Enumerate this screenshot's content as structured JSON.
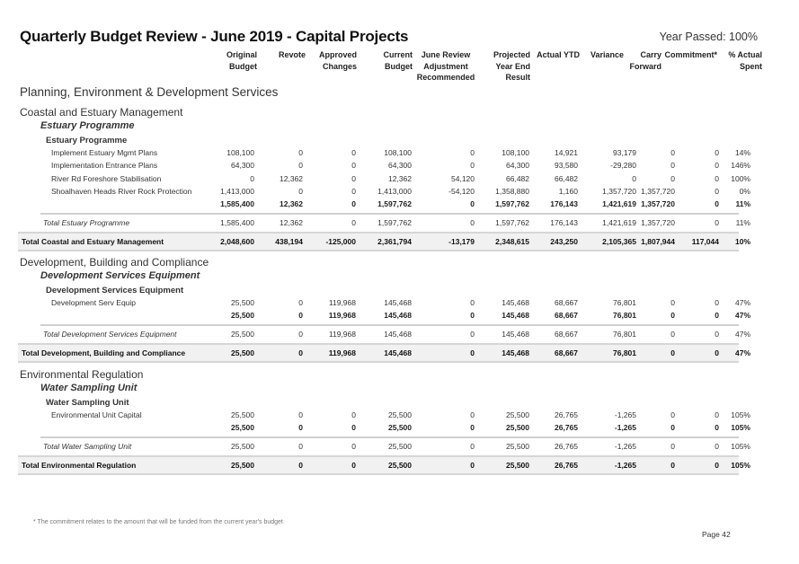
{
  "title": "Quarterly Budget Review - June 2019 - Capital Projects",
  "year_passed": "Year Passed: 100%",
  "columns": [
    {
      "line1": "Original",
      "line2": "Budget",
      "line3": ""
    },
    {
      "line1": "Revote",
      "line2": "",
      "line3": ""
    },
    {
      "line1": "Approved",
      "line2": "Changes",
      "line3": ""
    },
    {
      "line1": "Current",
      "line2": "Budget",
      "line3": ""
    },
    {
      "line1": "June Review",
      "line2": "Adjustment",
      "line3": "Recommended"
    },
    {
      "line1": "Projected",
      "line2": "Year End",
      "line3": "Result"
    },
    {
      "line1": "Actual YTD",
      "line2": "",
      "line3": ""
    },
    {
      "line1": "Variance",
      "line2": "",
      "line3": ""
    },
    {
      "line1": "Carry",
      "line2": "Forward",
      "line3": ""
    },
    {
      "line1": "Commitment*",
      "line2": "",
      "line3": ""
    },
    {
      "line1": "% Actual",
      "line2": "Spent",
      "line3": ""
    }
  ],
  "department": "Planning, Environment & Development Services",
  "sections": [
    {
      "name": "Coastal and Estuary Management",
      "programme_italic": "Estuary Programme",
      "programme_bold": "Estuary Programme",
      "rows": [
        {
          "label": "Implement Estuary Mgmt Plans",
          "values": [
            "108,100",
            "0",
            "0",
            "108,100",
            "0",
            "108,100",
            "14,921",
            "93,179",
            "0",
            "0",
            "14%"
          ]
        },
        {
          "label": "Implementation Entrance Plans",
          "values": [
            "64,300",
            "0",
            "0",
            "64,300",
            "0",
            "64,300",
            "93,580",
            "-29,280",
            "0",
            "0",
            "146%"
          ]
        },
        {
          "label": "River Rd Foreshore Stabilisation",
          "values": [
            "0",
            "12,362",
            "0",
            "12,362",
            "54,120",
            "66,482",
            "66,482",
            "0",
            "0",
            "0",
            "100%"
          ]
        },
        {
          "label": "Shoalhaven Heads River Rock Protection",
          "values": [
            "1,413,000",
            "0",
            "0",
            "1,413,000",
            "-54,120",
            "1,358,880",
            "1,160",
            "1,357,720",
            "1,357,720",
            "0",
            "0%"
          ]
        }
      ],
      "subtotal": [
        "1,585,400",
        "12,362",
        "0",
        "1,597,762",
        "0",
        "1,597,762",
        "176,143",
        "1,421,619",
        "1,357,720",
        "0",
        "11%"
      ],
      "programme_total_label": "Total Estuary Programme",
      "programme_total": [
        "1,585,400",
        "12,362",
        "0",
        "1,597,762",
        "0",
        "1,597,762",
        "176,143",
        "1,421,619",
        "1,357,720",
        "0",
        "11%"
      ],
      "section_total_label": "Total Coastal and Estuary Management",
      "section_total": [
        "2,048,600",
        "438,194",
        "-125,000",
        "2,361,794",
        "-13,179",
        "2,348,615",
        "243,250",
        "2,105,365",
        "1,807,944",
        "117,044",
        "10%"
      ]
    },
    {
      "name": "Development, Building and Compliance",
      "programme_italic": "Development Services Equipment",
      "programme_bold": "Development Services Equipment",
      "rows": [
        {
          "label": "Development Serv Equip",
          "values": [
            "25,500",
            "0",
            "119,968",
            "145,468",
            "0",
            "145,468",
            "68,667",
            "76,801",
            "0",
            "0",
            "47%"
          ]
        }
      ],
      "subtotal": [
        "25,500",
        "0",
        "119,968",
        "145,468",
        "0",
        "145,468",
        "68,667",
        "76,801",
        "0",
        "0",
        "47%"
      ],
      "programme_total_label": "Total Development Services Equipment",
      "programme_total": [
        "25,500",
        "0",
        "119,968",
        "145,468",
        "0",
        "145,468",
        "68,667",
        "76,801",
        "0",
        "0",
        "47%"
      ],
      "section_total_label": "Total Development, Building and Compliance",
      "section_total": [
        "25,500",
        "0",
        "119,968",
        "145,468",
        "0",
        "145,468",
        "68,667",
        "76,801",
        "0",
        "0",
        "47%"
      ]
    },
    {
      "name": "Environmental Regulation",
      "programme_italic": "Water Sampling Unit",
      "programme_bold": "Water Sampling Unit",
      "rows": [
        {
          "label": "Environmental Unit Capital",
          "values": [
            "25,500",
            "0",
            "0",
            "25,500",
            "0",
            "25,500",
            "26,765",
            "-1,265",
            "0",
            "0",
            "105%"
          ]
        }
      ],
      "subtotal": [
        "25,500",
        "0",
        "0",
        "25,500",
        "0",
        "25,500",
        "26,765",
        "-1,265",
        "0",
        "0",
        "105%"
      ],
      "programme_total_label": "Total Water Sampling Unit",
      "programme_total": [
        "25,500",
        "0",
        "0",
        "25,500",
        "0",
        "25,500",
        "26,765",
        "-1,265",
        "0",
        "0",
        "105%"
      ],
      "section_total_label": "Total Environmental Regulation",
      "section_total": [
        "25,500",
        "0",
        "0",
        "25,500",
        "0",
        "25,500",
        "26,765",
        "-1,265",
        "0",
        "0",
        "105%"
      ]
    }
  ],
  "footnote": "* The commitment relates to the amount that will be funded from the current year's budget",
  "page": "Page 42"
}
